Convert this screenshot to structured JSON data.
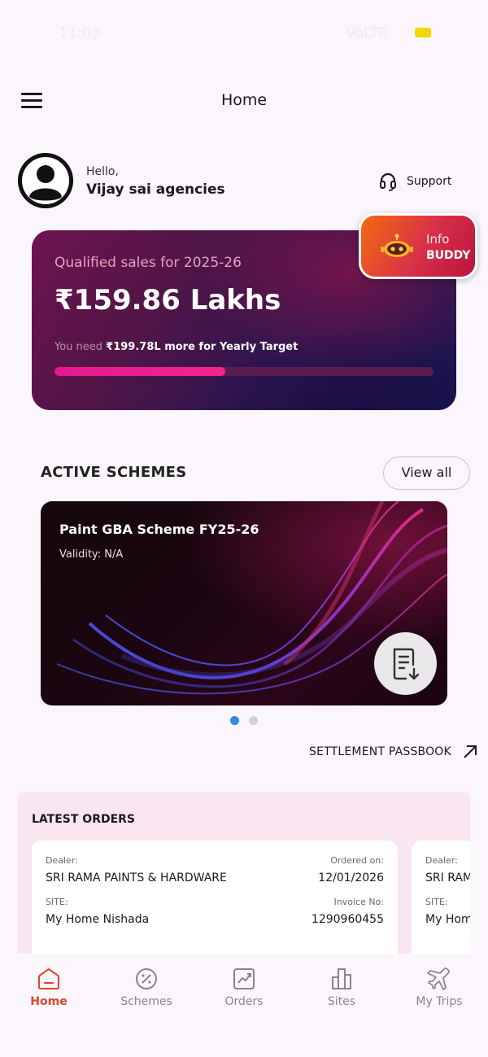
{
  "status_bar": {
    "time": "11:03",
    "right_text": "VoLTE",
    "battery_color": "#f4d60a"
  },
  "header": {
    "title": "Home"
  },
  "user": {
    "greeting": "Hello,",
    "name": "Vijay sai agencies"
  },
  "support": {
    "label": "Support"
  },
  "sales_card": {
    "label": "Qualified sales for 2025-26",
    "value": "₹159.86 Lakhs",
    "target_prefix": "You need",
    "target_amount": "₹199.78L more for Yearly Target",
    "progress_fraction": 0.45
  },
  "buddy": {
    "line1": "Info",
    "line2": "BUDDY"
  },
  "active_schemes": {
    "title": "ACTIVE SCHEMES",
    "view_all": "View all",
    "cards": [
      {
        "name": "Paint GBA Scheme FY25-26",
        "validity": "Validity: N/A"
      }
    ],
    "carousel_index": 0,
    "carousel_count": 2
  },
  "settlement": {
    "label": "SETTLEMENT PASSBOOK"
  },
  "latest_orders": {
    "title": "LATEST ORDERS",
    "orders": [
      {
        "dealer_label": "Dealer:",
        "dealer": "SRI RAMA PAINTS & HARDWARE",
        "ordered_on_label": "Ordered on:",
        "ordered_on": "12/01/2026",
        "site_label": "SITE:",
        "site": "My Home Nishada",
        "invoice_label": "Invoice No:",
        "invoice": "1290960455"
      },
      {
        "dealer_label": "Dealer:",
        "dealer": "SRI RAMA PAINTS & HARDWARE",
        "site_label": "SITE:",
        "site": "My Home Nishada"
      }
    ]
  },
  "bottom_nav": {
    "items": [
      {
        "label": "Home",
        "icon": "home-icon",
        "active": true
      },
      {
        "label": "Schemes",
        "icon": "badge-percent-icon",
        "active": false
      },
      {
        "label": "Orders",
        "icon": "chart-up-icon",
        "active": false
      },
      {
        "label": "Sites",
        "icon": "building-icon",
        "active": false
      },
      {
        "label": "My Trips",
        "icon": "airplane-icon",
        "active": false
      }
    ],
    "active_color": "#e0452a",
    "inactive_color": "#8a858d"
  },
  "colors": {
    "background": "#fbf6fb",
    "progress_fill": "#e21a8e",
    "carousel_active": "#2e8ee0",
    "orders_bg": "#f9e6f1"
  }
}
